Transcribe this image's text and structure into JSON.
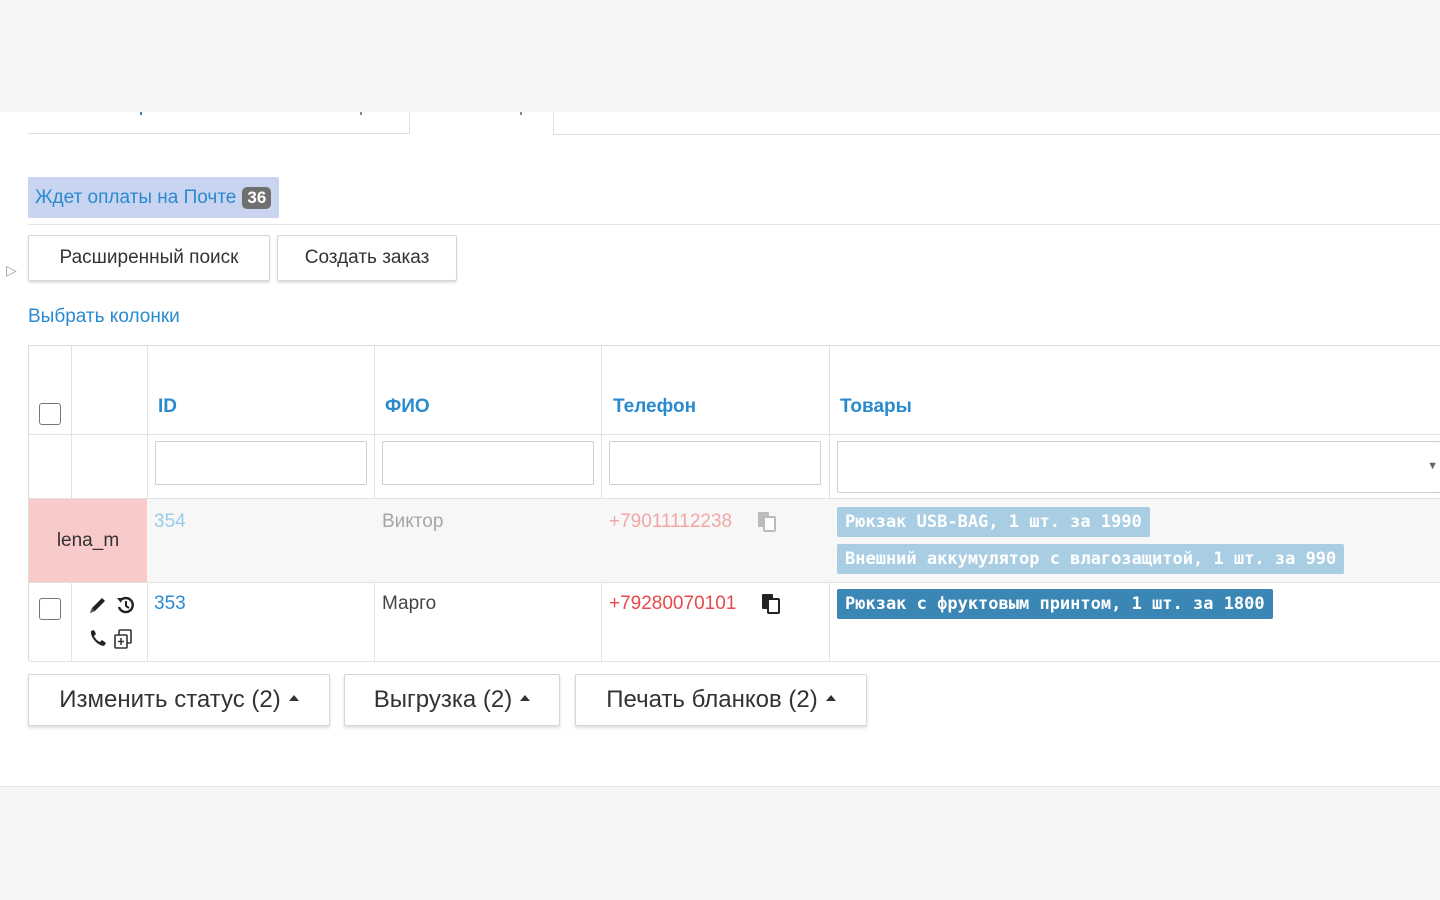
{
  "filters": {
    "status_label": "Ждет оплаты на Почте",
    "status_count": "36"
  },
  "toolbar": {
    "advanced_search": "Расширенный поиск",
    "create_order": "Создать заказ",
    "choose_columns": "Выбрать колонки"
  },
  "table": {
    "columns": [
      "ID",
      "ФИО",
      "Телефон",
      "Товары"
    ],
    "rows": [
      {
        "manager": "lena_m",
        "id": "354",
        "name": "Виктор",
        "phone": "+79011112238",
        "products": [
          "Рюкзак USB-BAG, 1 шт. за 1990",
          "Внешний аккумулятор с влагозащитой, 1 шт. за 990"
        ],
        "state": "faded"
      },
      {
        "manager": "",
        "id": "353",
        "name": "Марго",
        "phone": "+79280070101",
        "products": [
          "Рюкзак с фруктовым принтом, 1 шт. за 1800"
        ],
        "state": "active"
      }
    ]
  },
  "actions": {
    "change_status": "Изменить статус (2)",
    "export": "Выгрузка (2)",
    "print_forms": "Печать бланков (2)"
  },
  "colors": {
    "link": "#2a8ad0",
    "phone": "#e8494a",
    "status_bg": "#c9d4f0",
    "manager_bg": "#f9caca",
    "tag": "#3a87b6"
  }
}
